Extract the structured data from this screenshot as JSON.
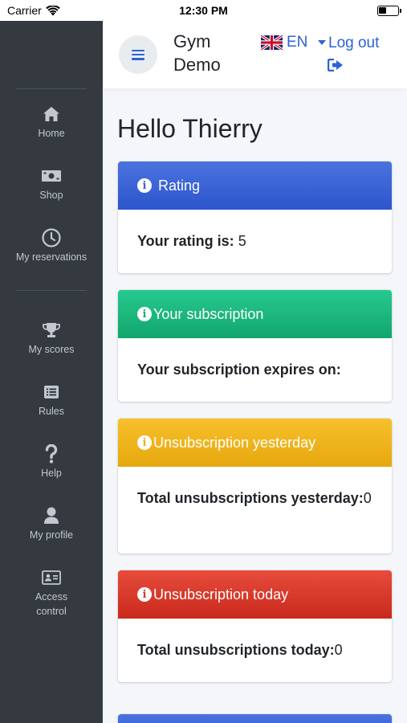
{
  "status_bar": {
    "carrier": "Carrier",
    "time": "12:30 PM"
  },
  "header": {
    "brand": "Gym Demo",
    "language": "EN",
    "language_icon": "uk-flag-icon",
    "logout_label": "Log out",
    "logout_icon": "sign-out-icon",
    "menu_icon": "hamburger-icon"
  },
  "sidebar": {
    "items": [
      {
        "label": "Home",
        "icon": "home-icon"
      },
      {
        "label": "Shop",
        "icon": "money-bill-icon"
      },
      {
        "label": "My reservations",
        "icon": "clock-icon"
      },
      {
        "label": "My scores",
        "icon": "trophy-icon"
      },
      {
        "label": "Rules",
        "icon": "list-alt-icon"
      },
      {
        "label": "Help",
        "icon": "question-icon"
      },
      {
        "label": "My profile",
        "icon": "user-icon"
      },
      {
        "label": "Access control",
        "icon": "id-card-icon"
      }
    ]
  },
  "main": {
    "greeting": "Hello Thierry",
    "cards": [
      {
        "title": "Rating",
        "label": "Your rating is:",
        "value": "5",
        "color": "#2d55cc"
      },
      {
        "title": "Your subscription",
        "label": "Your subscription expires on:",
        "value": "",
        "color": "#12a66d"
      },
      {
        "title": "Unsubscription yesterday",
        "label": "Total unsubscriptions yesterday:",
        "value": "0",
        "color": "#e6a80e"
      },
      {
        "title": "Unsubscription today",
        "label": "Total unsubscriptions today:",
        "value": "0",
        "color": "#c9291c"
      }
    ]
  }
}
